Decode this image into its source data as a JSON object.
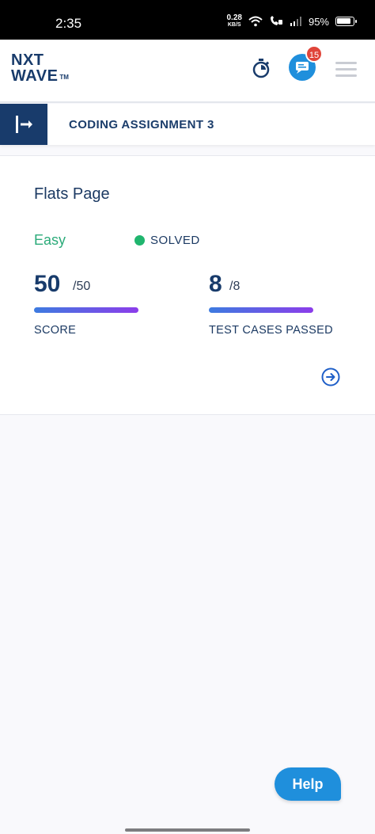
{
  "status_bar": {
    "time": "2:35",
    "network_speed": "0.28",
    "network_unit": "KB/S",
    "battery": "95%"
  },
  "header": {
    "logo_line1": "NXT",
    "logo_line2": "WAVE",
    "logo_tm": "TM",
    "timer_icon": "stopwatch-icon",
    "chat_icon": "chat-icon",
    "chat_badge_count": "15",
    "menu_icon": "hamburger-menu-icon",
    "brand_color": "#183b6b",
    "accent_color": "#1f8fdc"
  },
  "assignment": {
    "title": "CODING ASSIGNMENT 3"
  },
  "question": {
    "title": "Flats Page",
    "difficulty": "Easy",
    "status": "SOLVED",
    "score": "50",
    "score_total": "/50",
    "score_label": "SCORE",
    "score_fraction": 1.0,
    "tests_passed": "8",
    "tests_total": "/8",
    "tests_label": "TEST CASES PASSED",
    "tests_fraction": 1.0
  },
  "help": {
    "label": "Help"
  }
}
